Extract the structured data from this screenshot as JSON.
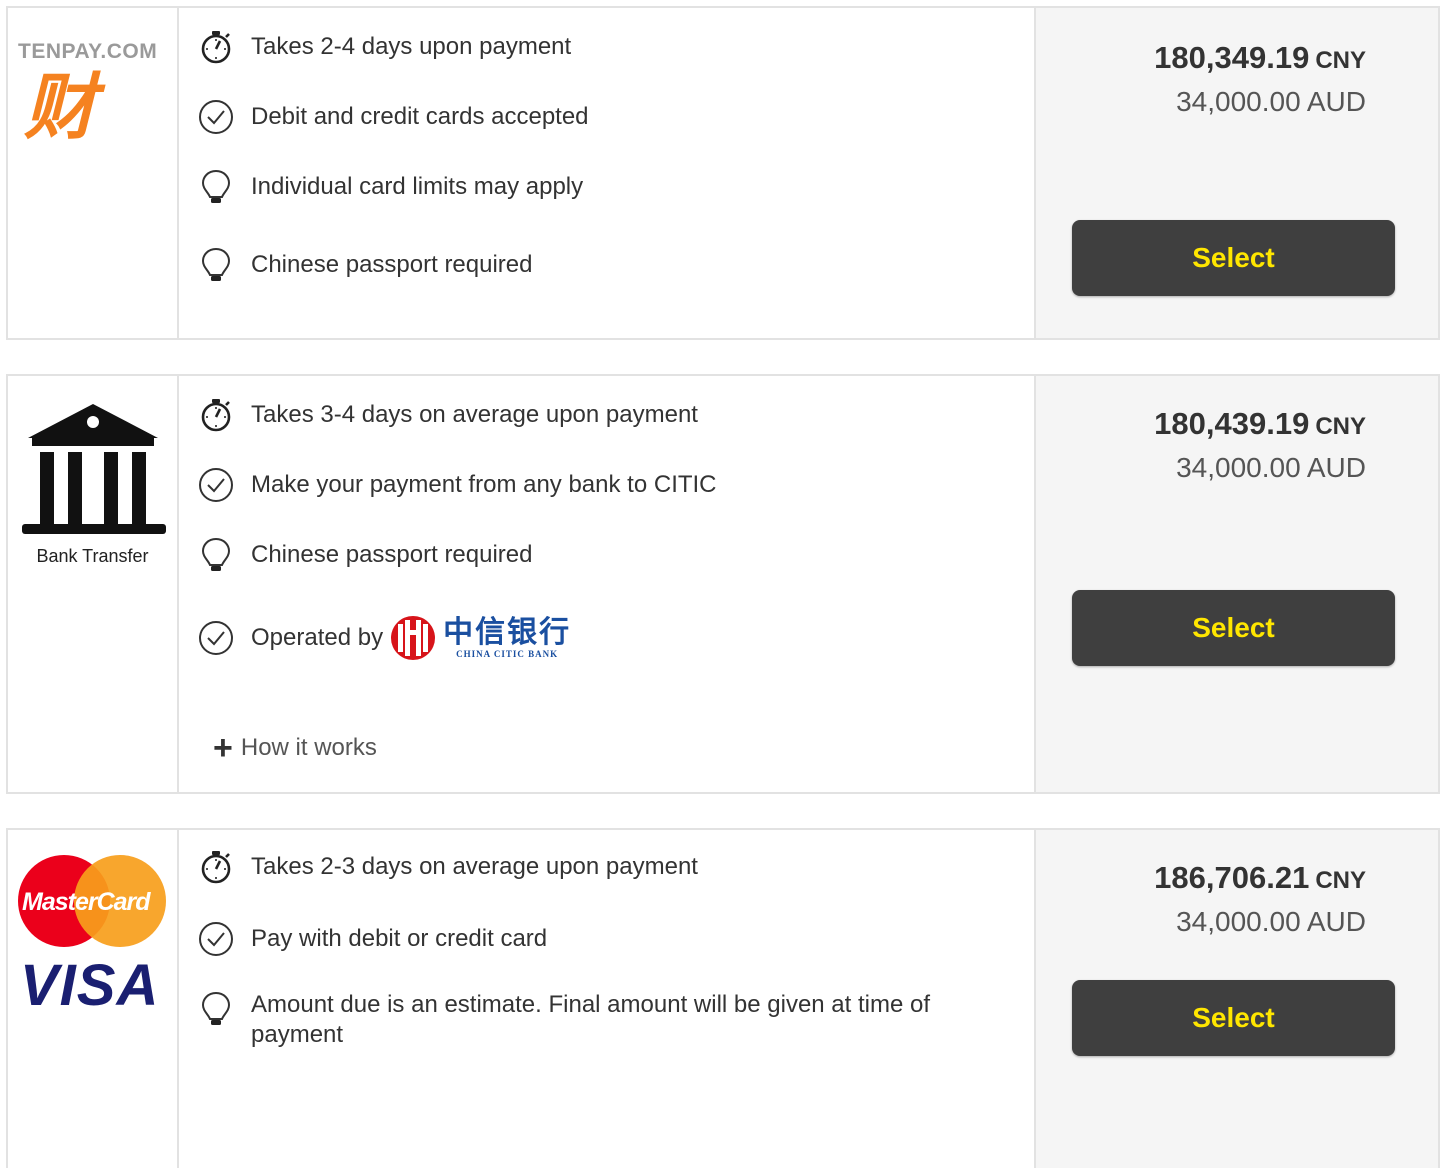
{
  "colors": {
    "button_bg": "#3f3f3f",
    "button_text": "#ffe600",
    "tenpay_orange": "#f58220",
    "citic_red": "#d7141a",
    "citic_blue": "#1a4fa0",
    "visa_blue": "#1a1f71",
    "mastercard_red": "#eb001b",
    "mastercard_orange": "#f79e1b"
  },
  "options": [
    {
      "logo": {
        "brand_text": "TENPAY.COM",
        "glyph": "财",
        "icon": "tenpay-logo"
      },
      "features": [
        {
          "icon": "stopwatch-icon",
          "text": "Takes 2-4 days upon payment"
        },
        {
          "icon": "check-circle-icon",
          "text": "Debit and credit cards accepted"
        },
        {
          "icon": "lightbulb-icon",
          "text": "Individual card limits may apply"
        },
        {
          "icon": "lightbulb-icon",
          "text": "Chinese passport required"
        }
      ],
      "price": {
        "amount": "180,349.19",
        "currency": "CNY",
        "source": "34,000.00 AUD"
      },
      "select_label": "Select"
    },
    {
      "logo": {
        "label": "Bank Transfer",
        "icon": "bank-icon"
      },
      "features": [
        {
          "icon": "stopwatch-icon",
          "text": "Takes 3-4 days on average upon payment"
        },
        {
          "icon": "check-circle-icon",
          "text": "Make your payment from any bank to CITIC"
        },
        {
          "icon": "lightbulb-icon",
          "text": "Chinese passport required"
        },
        {
          "icon": "check-circle-icon",
          "text": "Operated by"
        }
      ],
      "operator": {
        "name_cn": "中信银行",
        "name_en": "CHINA CITIC BANK"
      },
      "how_it_works": "How it works",
      "price": {
        "amount": "180,439.19",
        "currency": "CNY",
        "source": "34,000.00 AUD"
      },
      "select_label": "Select"
    },
    {
      "logo": {
        "mastercard_text": "MasterCard",
        "visa_text": "VISA",
        "icon": "mastercard-visa-logo"
      },
      "features": [
        {
          "icon": "stopwatch-icon",
          "text": "Takes 2-3 days on average upon payment"
        },
        {
          "icon": "check-circle-icon",
          "text": "Pay with debit or credit card"
        },
        {
          "icon": "lightbulb-icon",
          "text": "Amount due is an estimate. Final amount will be given at time of payment"
        }
      ],
      "price": {
        "amount": "186,706.21",
        "currency": "CNY",
        "source": "34,000.00 AUD"
      },
      "select_label": "Select"
    }
  ]
}
